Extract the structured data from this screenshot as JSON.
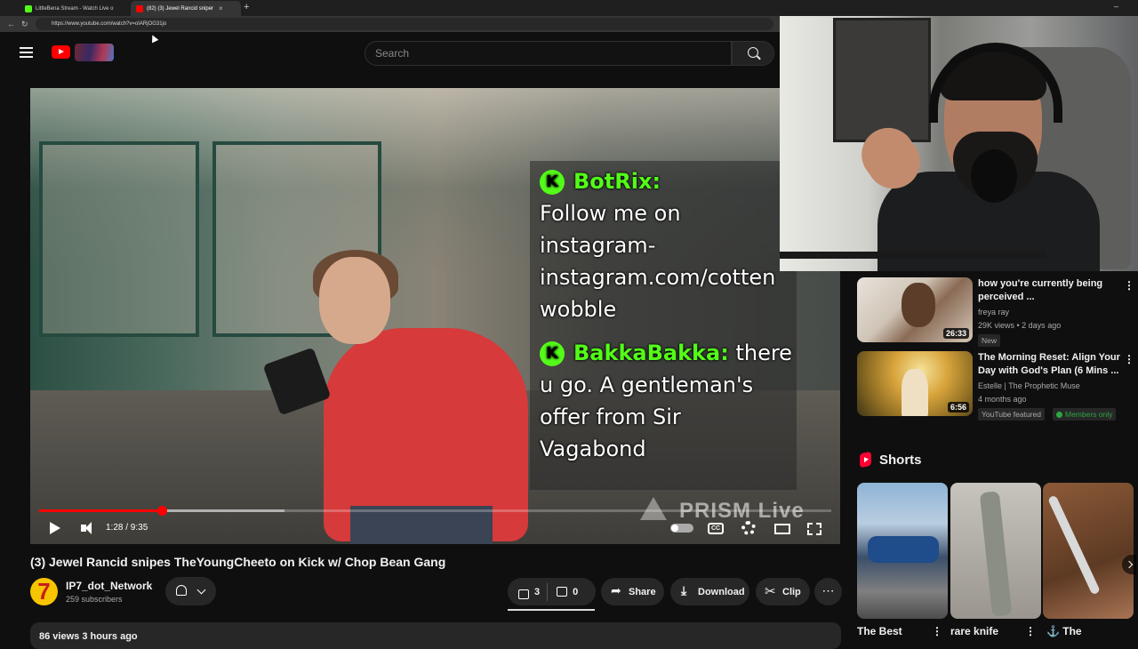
{
  "browser": {
    "tabs": [
      {
        "title": "LittleBena Stream - Watch Live o",
        "favicon_color": "#53fc18",
        "active": false
      },
      {
        "title": "(82) (3) Jewel Rancid sniper",
        "favicon_color": "#ff0000",
        "active": true
      }
    ],
    "new_tab": "+",
    "url": "https://www.youtube.com/watch?v=oIARjOG31jo"
  },
  "header": {
    "search_placeholder": "Search"
  },
  "video": {
    "chat_messages": [
      {
        "user": "BotRix:",
        "text": "Follow me on\ninstagram-\ninstagram.com/cotten\nwobble"
      },
      {
        "user": "BakkaBakka:",
        "text": "there\nu go. A gentleman's\noffer from Sir\nVagabond"
      }
    ],
    "watermark": "PRISM Live",
    "time_display": "1:28 / 9:35",
    "progress_played": 0.155,
    "progress_buffered": 0.31,
    "cc_label": "CC"
  },
  "title": "(3) Jewel Rancid snipes TheYoungCheeto on Kick w/ Chop Bean Gang",
  "channel": {
    "avatar_text": "7",
    "name": "IP7_dot_Network",
    "subscribers": "259 subscribers"
  },
  "actions": {
    "likes": "3",
    "dislikes": "0",
    "share": "Share",
    "download": "Download",
    "clip": "Clip",
    "more": "⋯"
  },
  "description": {
    "stats": "86 views  3 hours ago"
  },
  "recommendations": [
    {
      "title_line1": "how you're currently being",
      "title_line2": "perceived ...",
      "channel": "freya ray",
      "meta": "29K views • 2 days ago",
      "badge": "New",
      "duration": "26:33"
    },
    {
      "title_line1": "The Morning Reset: Align Your",
      "title_line2": "Day with God's Plan (6 Mins ...",
      "channel": "Estelle | The Prophetic Muse",
      "meta": "4 months ago",
      "badge": "YouTube featured",
      "badge2": "Members only",
      "duration": "6:56"
    }
  ],
  "shorts": {
    "label": "Shorts",
    "items": [
      {
        "title": "The Best"
      },
      {
        "title": "rare knife"
      },
      {
        "title": "⚓ The"
      }
    ]
  },
  "colors": {
    "accent": "#ff0000",
    "kick_green": "#53fc18",
    "background": "#0f0f0f"
  }
}
